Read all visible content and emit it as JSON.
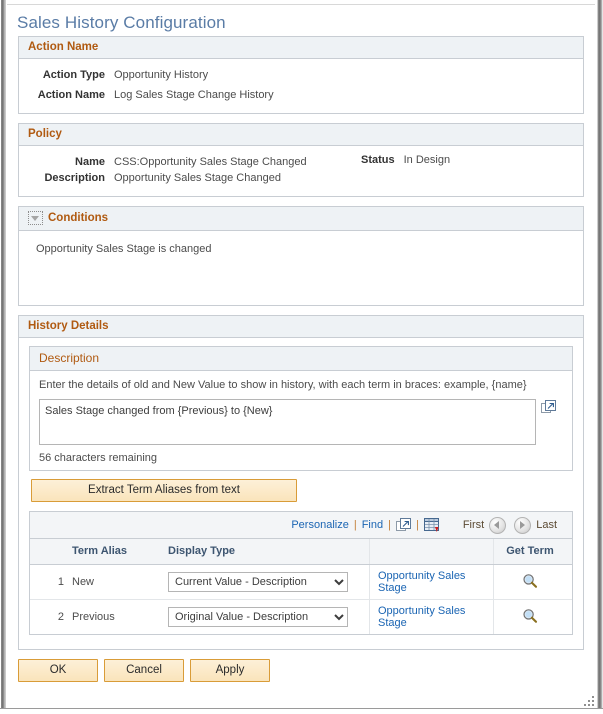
{
  "page": {
    "title": "Sales History Configuration"
  },
  "action_name_group": {
    "header": "Action Name",
    "fields": [
      {
        "label": "Action Type",
        "value": "Opportunity History"
      },
      {
        "label": "Action Name",
        "value": "Log Sales Stage Change History"
      }
    ]
  },
  "policy_group": {
    "header": "Policy",
    "name_label": "Name",
    "name_value": "CSS:Opportunity Sales Stage Changed",
    "description_label": "Description",
    "description_value": "Opportunity Sales Stage Changed",
    "status_label": "Status",
    "status_value": "In Design"
  },
  "conditions_group": {
    "header": "Conditions",
    "collapse_icon": "triangle-down-icon",
    "text": "Opportunity Sales Stage is changed"
  },
  "history_details_group": {
    "header": "History Details",
    "description_panel": {
      "header": "Description",
      "hint": "Enter the details of old and New Value to show in history, with each term in braces: example, {name}",
      "textarea_value": "Sales Stage changed from {Previous} to {New}",
      "textarea_placeholder": "",
      "expand_icon": "expand-window-icon",
      "characters_remaining": "56 characters remaining"
    },
    "extract_button": "Extract Term Aliases from text"
  },
  "grid": {
    "toolbar": {
      "personalize": "Personalize",
      "find": "Find",
      "separator": "|",
      "view_all_icon": "new-window-icon",
      "download_icon": "grid-download-icon",
      "first_label": "First",
      "prev_icon": "arrow-left-icon",
      "next_icon": "arrow-right-icon",
      "last_label": "Last"
    },
    "columns": [
      "",
      "Term Alias",
      "Display Type",
      "",
      "Get Term"
    ],
    "rows": [
      {
        "num": "1",
        "term_alias": "New",
        "display_type": "Current Value - Description",
        "term_link": "Opportunity Sales Stage",
        "get_term_icon": "search-icon"
      },
      {
        "num": "2",
        "term_alias": "Previous",
        "display_type": "Original Value - Description",
        "term_link": "Opportunity Sales Stage",
        "get_term_icon": "search-icon"
      }
    ],
    "display_type_options": [
      "Current Value - Description",
      "Original Value - Description"
    ]
  },
  "footer": {
    "ok": "OK",
    "cancel": "Cancel",
    "apply": "Apply"
  },
  "colors": {
    "group_header_text": "#b05a11",
    "page_title": "#5a7ca6",
    "link": "#1b65b3",
    "button_border": "#d99c38",
    "column_header_text": "#3d5570"
  }
}
